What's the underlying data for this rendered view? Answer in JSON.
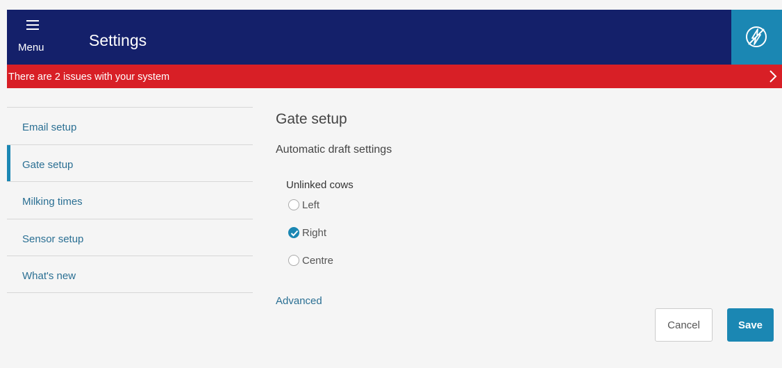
{
  "header": {
    "menu_label": "Menu",
    "title": "Settings",
    "menu_icon": "hamburger-icon",
    "power_icon": "lightning-off-icon",
    "background_color": "#14206a",
    "accent_color": "#1b87b3"
  },
  "alert": {
    "text": "There are 2 issues with your system",
    "background_color": "#d81f26",
    "chevron_icon": "chevron-right-icon"
  },
  "sidebar": {
    "items": [
      {
        "label": "Email setup",
        "active": false
      },
      {
        "label": "Gate setup",
        "active": true
      },
      {
        "label": "Milking times",
        "active": false
      },
      {
        "label": "Sensor setup",
        "active": false
      },
      {
        "label": "What's new",
        "active": false
      }
    ]
  },
  "main": {
    "title": "Gate setup",
    "subtitle": "Automatic draft settings",
    "group_label": "Unlinked cows",
    "options": [
      {
        "label": "Left",
        "checked": false
      },
      {
        "label": "Right",
        "checked": true
      },
      {
        "label": "Centre",
        "checked": false
      }
    ],
    "advanced_link": "Advanced",
    "cancel_label": "Cancel",
    "save_label": "Save"
  }
}
